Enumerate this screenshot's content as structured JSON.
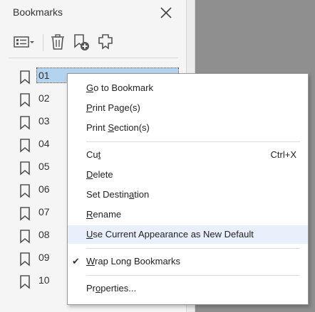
{
  "panel": {
    "title": "Bookmarks",
    "close_icon": "close-icon"
  },
  "toolbar": {
    "options_icon": "options-menu-icon",
    "delete_icon": "trash-icon",
    "new_bookmark_icon": "new-bookmark-icon",
    "expand_icon": "expand-bookmark-icon"
  },
  "bookmarks": [
    {
      "label": "01",
      "selected": true
    },
    {
      "label": "02"
    },
    {
      "label": "03"
    },
    {
      "label": "04"
    },
    {
      "label": "05"
    },
    {
      "label": "06"
    },
    {
      "label": "07"
    },
    {
      "label": "08"
    },
    {
      "label": "09"
    },
    {
      "label": "10"
    }
  ],
  "context_menu": {
    "group1": [
      {
        "pre": "",
        "ul": "G",
        "post": "o to Bookmark"
      },
      {
        "pre": "",
        "ul": "P",
        "post": "rint Page(s)"
      },
      {
        "pre": "Print ",
        "ul": "S",
        "post": "ection(s)"
      }
    ],
    "group2": [
      {
        "pre": "Cu",
        "ul": "t",
        "post": "",
        "shortcut": "Ctrl+X"
      },
      {
        "pre": "",
        "ul": "D",
        "post": "elete"
      },
      {
        "pre": "Set Destin",
        "ul": "a",
        "post": "tion"
      },
      {
        "pre": "",
        "ul": "R",
        "post": "ename"
      },
      {
        "pre": "",
        "ul": "U",
        "post": "se Current Appearance as New Default",
        "hover": true
      }
    ],
    "group3": [
      {
        "pre": "",
        "ul": "W",
        "post": "rap Long Bookmarks",
        "checked": true
      }
    ],
    "group4": [
      {
        "pre": "Pr",
        "ul": "o",
        "post": "perties..."
      }
    ]
  },
  "colors": {
    "selection": "#b3d3ee",
    "hover": "#e8f1fb",
    "document_bg": "#8f8f8f"
  }
}
